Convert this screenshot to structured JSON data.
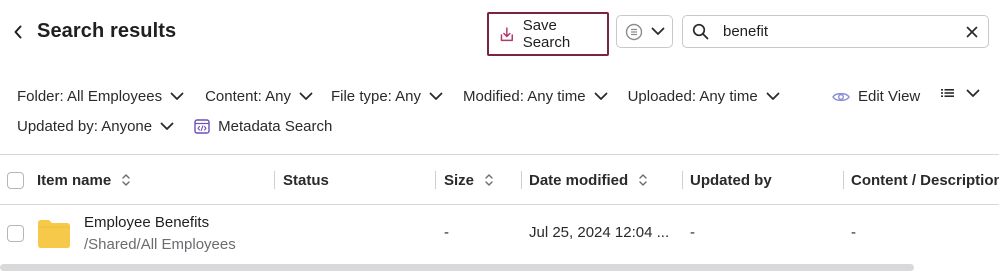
{
  "header": {
    "title": "Search results",
    "save_search_label": "Save Search",
    "search": {
      "value": "benefit",
      "placeholder": ""
    }
  },
  "filters": [
    {
      "label": "Folder: All Employees",
      "icon": "chevron-down-icon"
    },
    {
      "label": "Content: Any",
      "icon": "chevron-down-icon"
    },
    {
      "label": "File type: Any",
      "icon": "chevron-down-icon"
    },
    {
      "label": "Modified: Any time",
      "icon": "chevron-down-icon"
    },
    {
      "label": "Uploaded: Any time",
      "icon": "chevron-down-icon"
    },
    {
      "label": "Updated by: Anyone",
      "icon": "chevron-down-icon"
    }
  ],
  "metadata_search_label": "Metadata Search",
  "edit_view_label": "Edit View",
  "table": {
    "columns": [
      {
        "label": "Item name",
        "sortable": true
      },
      {
        "label": "Status",
        "sortable": false
      },
      {
        "label": "Size",
        "sortable": true
      },
      {
        "label": "Date modified",
        "sortable": true
      },
      {
        "label": "Updated by",
        "sortable": false
      },
      {
        "label": "Content / Description",
        "sortable": false
      }
    ],
    "rows": [
      {
        "name": "Employee Benefits",
        "path": "/Shared/All Employees",
        "status": "",
        "size": "-",
        "date_modified": "Jul 25, 2024 12:04 ...",
        "updated_by": "-",
        "content": "-"
      }
    ]
  },
  "colors": {
    "save_search_border": "#7a2444",
    "folder": "#f6c94b",
    "metadata_icon": "#6b4fbb",
    "edit_view_icon": "#8a8fd8"
  }
}
